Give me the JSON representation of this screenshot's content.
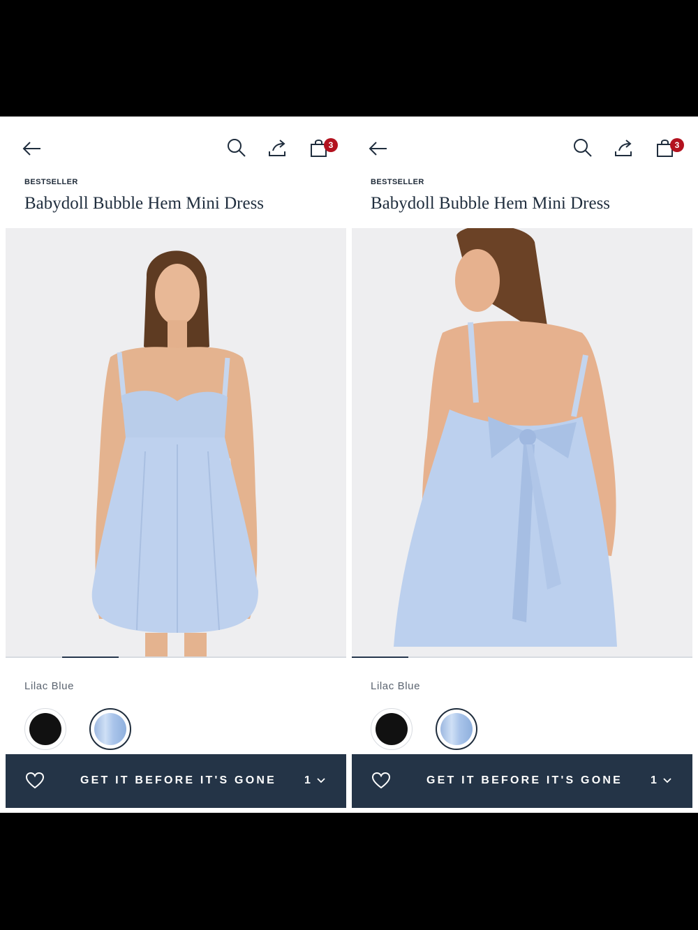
{
  "screens": [
    {
      "badge_count": "3",
      "eyebrow": "BESTSELLER",
      "product_title": "Babydoll Bubble Hem Mini Dress",
      "image_position": 1,
      "image_count": 6,
      "color_name": "Lilac Blue",
      "swatches": [
        {
          "name": "black",
          "color": "#111111",
          "selected": false
        },
        {
          "name": "lilac-blue",
          "color": "#b5cdef",
          "selected": true
        }
      ],
      "cta_label": "GET IT BEFORE IT'S GONE",
      "quantity": "1"
    },
    {
      "badge_count": "3",
      "eyebrow": "BESTSELLER",
      "product_title": "Babydoll Bubble Hem Mini Dress",
      "image_position": 0,
      "image_count": 6,
      "color_name": "Lilac Blue",
      "swatches": [
        {
          "name": "black",
          "color": "#111111",
          "selected": false
        },
        {
          "name": "lilac-blue",
          "color": "#b5cdef",
          "selected": true
        }
      ],
      "cta_label": "GET IT BEFORE IT'S GONE",
      "quantity": "1"
    }
  ],
  "icons": {
    "back": "arrow-left-icon",
    "search": "search-icon",
    "share": "share-icon",
    "bag": "shopping-bag-icon",
    "wishlist": "heart-icon",
    "quantity_dropdown": "chevron-down-icon"
  },
  "colors": {
    "cta_background": "#243447",
    "badge_background": "#b3121f",
    "title_text": "#1f2d3d",
    "page_background": "#ffffff",
    "letterbox": "#000000"
  }
}
